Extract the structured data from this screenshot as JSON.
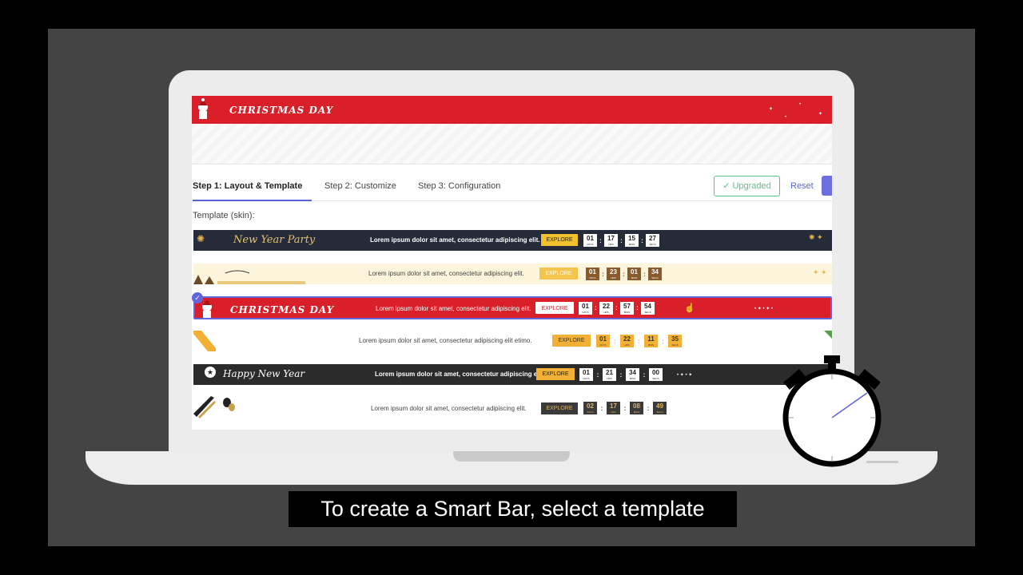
{
  "preview": {
    "title": "CHRISTMAS DAY"
  },
  "tabs": [
    {
      "label": "Step 1: Layout & Template"
    },
    {
      "label": "Step 2: Customize"
    },
    {
      "label": "Step 3: Configuration"
    }
  ],
  "actions": {
    "upgraded": "Upgraded",
    "reset": "Reset"
  },
  "template_label": "Template (skin):",
  "templates": [
    {
      "name": "New Year Party",
      "message": "Lorem ipsum dolor sit amet, consectetur adipiscing elit.",
      "button": "EXPLORE",
      "days": "01",
      "hrs": "17",
      "mins": "15",
      "secs": "27"
    },
    {
      "name": "",
      "message": "Lorem ipsum dolor sit amet, consectetur adipiscing elit.",
      "button": "EXPLORE",
      "days": "01",
      "hrs": "23",
      "mins": "01",
      "secs": "34"
    },
    {
      "name": "CHRISTMAS DAY",
      "message": "Lorem ipsum dolor sit amet, consectetur adipiscing elit.",
      "button": "EXPLORE",
      "days": "01",
      "hrs": "22",
      "mins": "57",
      "secs": "54",
      "selected": true
    },
    {
      "name": "",
      "message": "Lorem ipsum dolor sit amet, consectetur adipiscing elit etimo.",
      "button": "EXPLORE",
      "days": "01",
      "hrs": "22",
      "mins": "11",
      "secs": "35"
    },
    {
      "name": "Happy New Year",
      "message": "Lorem ipsum dolor sit amet, consectetur adipiscing elit.",
      "button": "EXPLORE",
      "days": "01",
      "hrs": "21",
      "mins": "34",
      "secs": "00"
    },
    {
      "name": "",
      "message": "Lorem ipsum dolor sit amet, consectetur adipiscing elit.",
      "button": "EXPLORE",
      "days": "02",
      "hrs": "17",
      "mins": "08",
      "secs": "49"
    }
  ],
  "units": {
    "days": "DAYS",
    "hrs": "HRS",
    "mins": "MINS",
    "secs": "SECS"
  },
  "caption": "To create a Smart Bar, select a template",
  "colors": {
    "accent": "#5a63d8",
    "christmas_red": "#d9202a",
    "upgraded_green": "#5cc08a",
    "explore_gold": "#f2b134"
  }
}
